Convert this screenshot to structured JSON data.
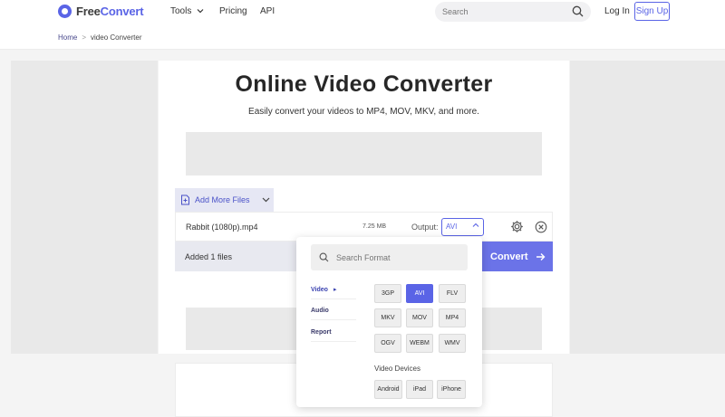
{
  "header": {
    "logo_primary": "Free",
    "logo_accent": "Convert",
    "nav": {
      "tools": "Tools",
      "pricing": "Pricing",
      "api": "API"
    },
    "search_placeholder": "Search",
    "login": "Log In",
    "signup": "Sign Up"
  },
  "breadcrumb": {
    "home": "Home",
    "separator": ">",
    "current": "video Converter"
  },
  "hero": {
    "title": "Online Video Converter",
    "subtitle": "Easily convert your videos to MP4, MOV, MKV, and more."
  },
  "files": {
    "add_more": "Add More Files",
    "file_name": "Rabbit (1080p).mp4",
    "file_size": "7.25 MB",
    "output_label": "Output:",
    "output_value": "AVI",
    "added_text": "Added 1 files",
    "convert": "Convert"
  },
  "format_panel": {
    "search_placeholder": "Search Format",
    "categories": {
      "video": "Video",
      "audio": "Audio",
      "report": "Report"
    },
    "formats": [
      "3GP",
      "AVI",
      "FLV",
      "MKV",
      "MOV",
      "MP4",
      "OGV",
      "WEBM",
      "WMV"
    ],
    "selected_format": "AVI",
    "devices_label": "Video Devices",
    "devices": [
      "Android",
      "iPad",
      "iPhone"
    ]
  },
  "colors": {
    "brand": "#5a64e6",
    "convert_button": "#6b73e8"
  }
}
